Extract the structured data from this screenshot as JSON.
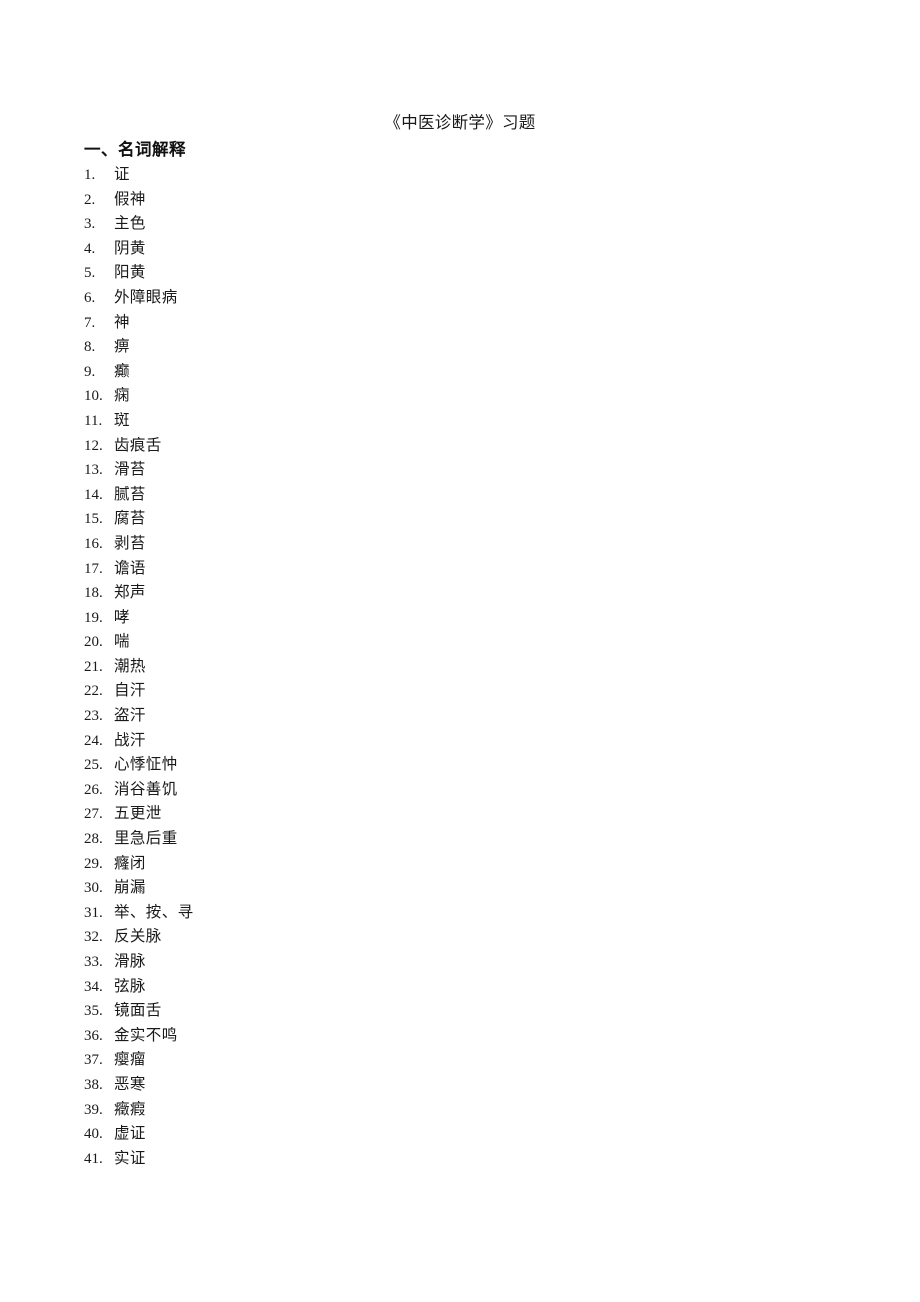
{
  "document": {
    "title": "《中医诊断学》习题",
    "section_heading": "一、名词解释",
    "terms": [
      {
        "num": "1.",
        "text": "证"
      },
      {
        "num": "2.",
        "text": "假神"
      },
      {
        "num": "3.",
        "text": "主色"
      },
      {
        "num": "4.",
        "text": "阴黄"
      },
      {
        "num": "5.",
        "text": "阳黄"
      },
      {
        "num": "6.",
        "text": "外障眼病"
      },
      {
        "num": "7.",
        "text": "神"
      },
      {
        "num": "8.",
        "text": "痹"
      },
      {
        "num": "9.",
        "text": "癫"
      },
      {
        "num": "10.",
        "text": "痫"
      },
      {
        "num": "11.",
        "text": "斑"
      },
      {
        "num": "12.",
        "text": "齿痕舌"
      },
      {
        "num": "13.",
        "text": "滑苔"
      },
      {
        "num": "14.",
        "text": "腻苔"
      },
      {
        "num": "15.",
        "text": "腐苔"
      },
      {
        "num": "16.",
        "text": "剥苔"
      },
      {
        "num": "17.",
        "text": "谵语"
      },
      {
        "num": "18.",
        "text": "郑声"
      },
      {
        "num": "19.",
        "text": "哮"
      },
      {
        "num": "20.",
        "text": "喘"
      },
      {
        "num": "21.",
        "text": "潮热"
      },
      {
        "num": "22.",
        "text": "自汗"
      },
      {
        "num": "23.",
        "text": "盗汗"
      },
      {
        "num": "24.",
        "text": "战汗"
      },
      {
        "num": "25.",
        "text": "心悸怔忡"
      },
      {
        "num": "26.",
        "text": "消谷善饥"
      },
      {
        "num": "27.",
        "text": "五更泄"
      },
      {
        "num": "28.",
        "text": "里急后重"
      },
      {
        "num": "29.",
        "text": "癃闭"
      },
      {
        "num": "30.",
        "text": "崩漏"
      },
      {
        "num": "31.",
        "text": "举、按、寻"
      },
      {
        "num": "32.",
        "text": "反关脉"
      },
      {
        "num": "33.",
        "text": "滑脉"
      },
      {
        "num": "34.",
        "text": "弦脉"
      },
      {
        "num": "35.",
        "text": "镜面舌"
      },
      {
        "num": "36.",
        "text": "金实不鸣"
      },
      {
        "num": "37.",
        "text": "瘿瘤"
      },
      {
        "num": "38.",
        "text": "恶寒"
      },
      {
        "num": "39.",
        "text": "癥瘕"
      },
      {
        "num": "40.",
        "text": "虚证"
      },
      {
        "num": "41.",
        "text": "实证"
      }
    ]
  }
}
